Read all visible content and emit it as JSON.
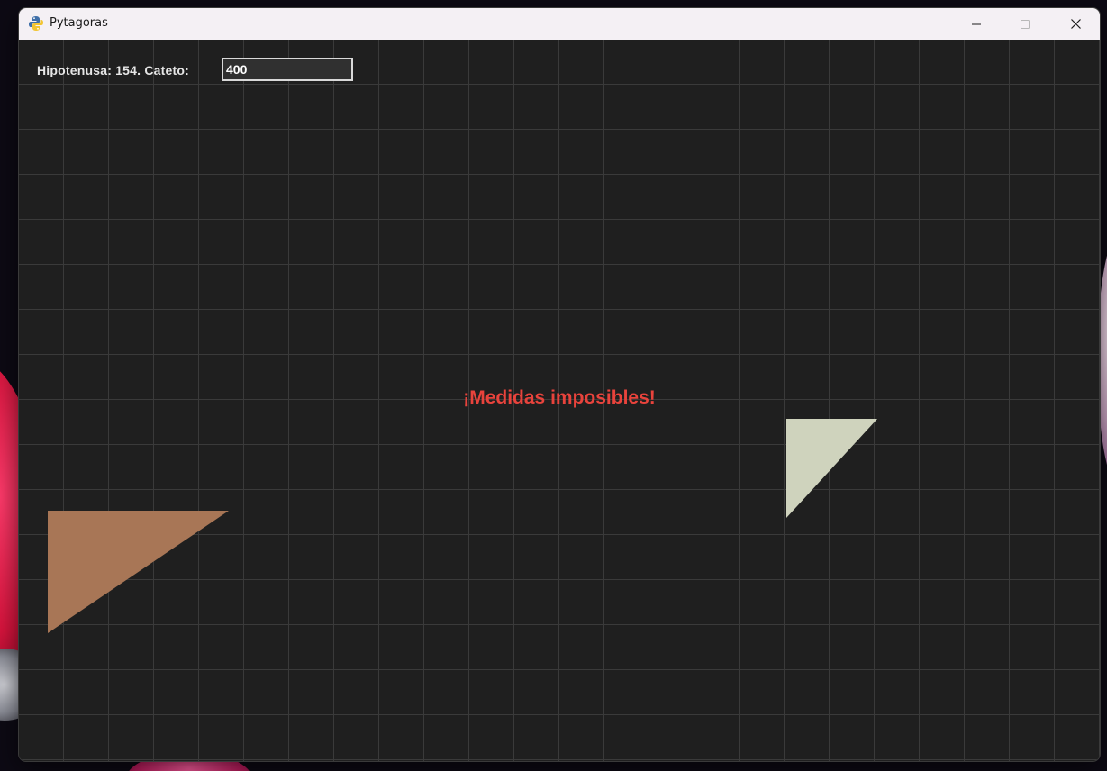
{
  "window": {
    "title": "Pytagoras",
    "icon": "python-icon"
  },
  "controls": {
    "label": "Hipotenusa: 154. Cateto:",
    "cateto_value": "400"
  },
  "message": {
    "text": "¡Medidas imposibles!",
    "color": "#e8433c"
  },
  "colors": {
    "triangle_left": "#a87656",
    "triangle_right": "#cfd3bd",
    "canvas_bg": "#1f1f1f",
    "grid": "#3a3a3a"
  }
}
